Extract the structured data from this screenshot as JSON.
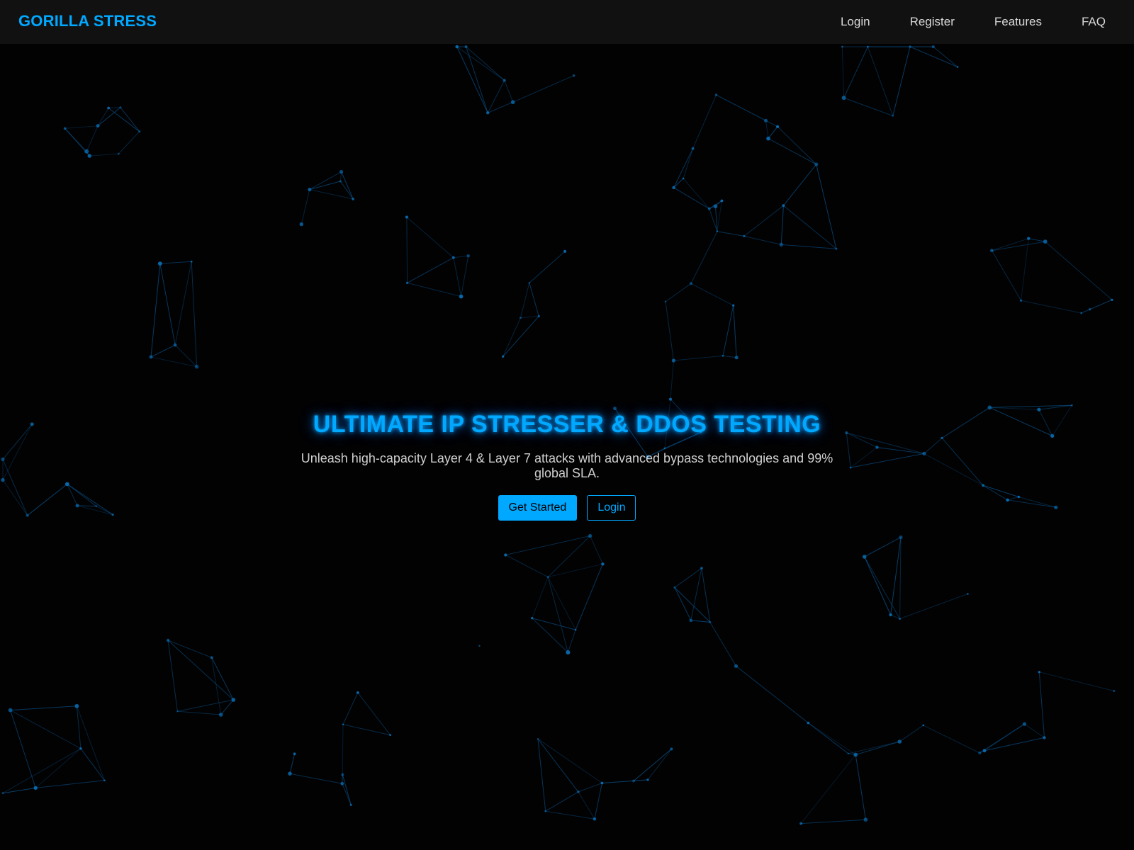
{
  "navbar": {
    "brand": "GORILLA STRESS",
    "links": [
      "Login",
      "Register",
      "Features",
      "FAQ"
    ]
  },
  "hero": {
    "title": "ULTIMATE IP STRESSER & DDOS TESTING",
    "subtitle": "Unleash high-capacity Layer 4 & Layer 7 attacks with advanced bypass technologies and 99% global SLA.",
    "primary_button": "Get Started",
    "secondary_button": "Login"
  },
  "colors": {
    "accent": "#00a8ff",
    "background": "#020203",
    "navbar": "#121212",
    "network_line": "#0b5f9e",
    "network_node": "#0a6fb5"
  },
  "background": {
    "type": "animated-particle-network"
  }
}
